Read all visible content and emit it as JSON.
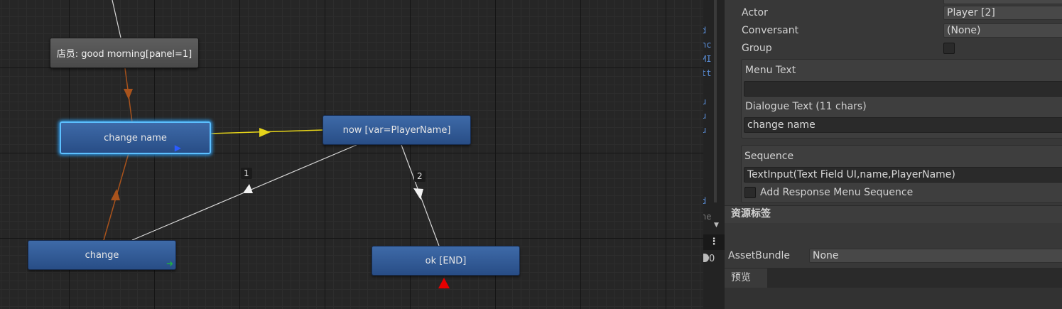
{
  "graph": {
    "nodes": [
      {
        "id": "n_greeting",
        "label": "店员: good morning[panel=1]"
      },
      {
        "id": "n_change_name",
        "label": "change name"
      },
      {
        "id": "n_now",
        "label": "now  [var=PlayerName]"
      },
      {
        "id": "n_change",
        "label": "change"
      },
      {
        "id": "n_ok",
        "label": "ok [END]"
      }
    ],
    "edge_labels": [
      "1",
      "2"
    ],
    "colors": {
      "link_orange": "#a9531c",
      "link_yellow": "#e6d41a",
      "link_white": "#d8d8d8",
      "node_blue": "#305a96",
      "node_gray": "#555555",
      "selected_outline": "#5cc0ff",
      "end_marker": "#e60000",
      "blue_marker": "#2a5cff",
      "green_marker": "#20b040"
    }
  },
  "strip": {
    "fragments": [
      "d",
      "nc",
      "MI",
      "tt",
      "u",
      "u",
      "u",
      "d",
      "ne"
    ],
    "menu_icon": "vertical-dots-icon",
    "counter": "0"
  },
  "inspector": {
    "actor": {
      "label": "Actor",
      "value": "Player [2]"
    },
    "conversant": {
      "label": "Conversant",
      "value": "(None)"
    },
    "group": {
      "label": "Group",
      "checked": false
    },
    "menu_text": {
      "label": "Menu Text",
      "value": ""
    },
    "dialogue_text": {
      "label": "Dialogue Text (11 chars)",
      "value": "change name"
    },
    "sequence": {
      "label": "Sequence",
      "value": "TextInput(Text Field UI,name,PlayerName)"
    },
    "add_response_menu_sequence": {
      "label": "Add Response Menu Sequence",
      "checked": false
    },
    "asset_labels": {
      "title": "资源标签"
    },
    "asset_bundle": {
      "label": "AssetBundle",
      "value": "None"
    },
    "preview": {
      "title": "预览"
    }
  }
}
